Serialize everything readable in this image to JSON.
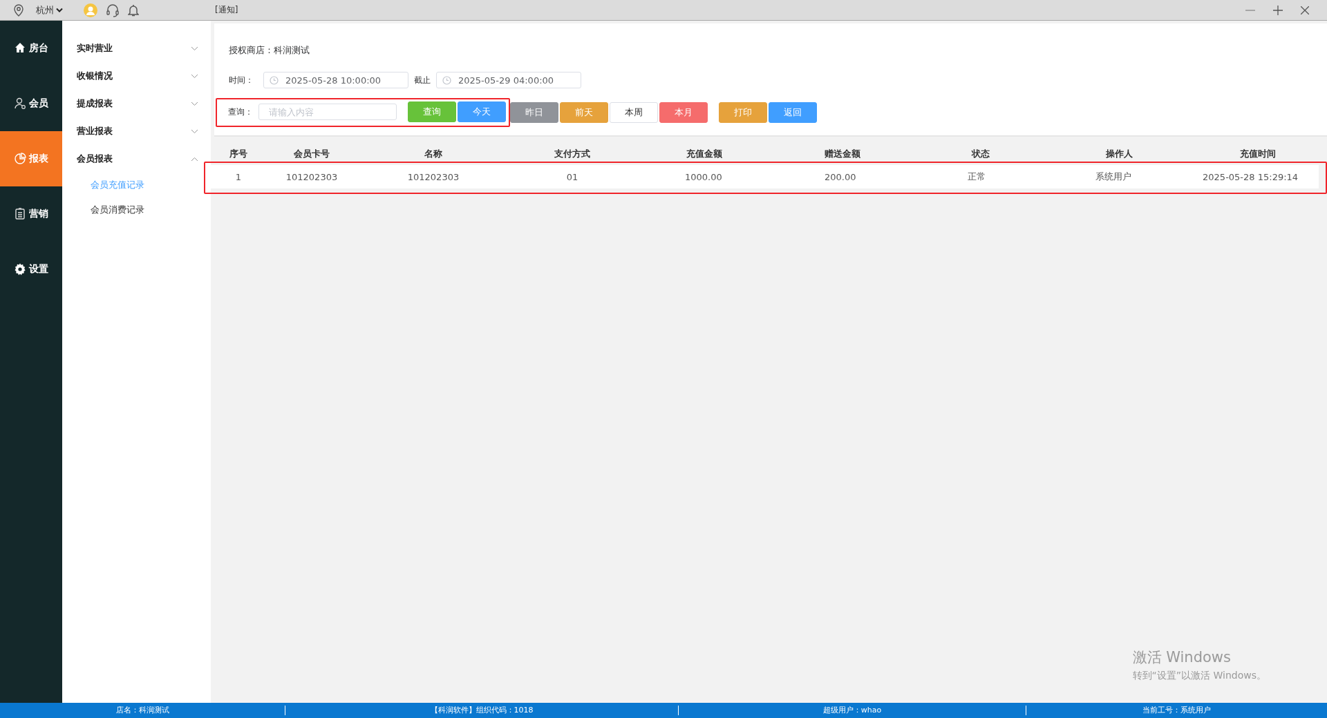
{
  "title_bar": {
    "city": "杭州",
    "notice": "[通知]"
  },
  "nav": [
    {
      "label": "房台",
      "selected": false
    },
    {
      "label": "会员",
      "selected": false
    },
    {
      "label": "报表",
      "selected": true
    },
    {
      "label": "营销",
      "selected": false
    },
    {
      "label": "设置",
      "selected": false
    }
  ],
  "menu": [
    {
      "label": "实时营业",
      "expanded": false
    },
    {
      "label": "收银情况",
      "expanded": false
    },
    {
      "label": "提成报表",
      "expanded": false
    },
    {
      "label": "营业报表",
      "expanded": false
    },
    {
      "label": "会员报表",
      "expanded": true,
      "children": [
        {
          "label": "会员充值记录",
          "selected": true
        },
        {
          "label": "会员消费记录",
          "selected": false
        }
      ]
    }
  ],
  "filter": {
    "shop": "授权商店：科润测试",
    "time_label": "时间：",
    "start": "2025-05-28 10:00:00",
    "until_label": "截止",
    "end": "2025-05-29 04:00:00",
    "query_label": "查询：",
    "placeholder": "请输入内容",
    "query_highlighted": true,
    "buttons": [
      {
        "label": "查询",
        "kind": "success"
      },
      {
        "label": "今天",
        "kind": "primary"
      },
      {
        "label": "昨日",
        "kind": "info"
      },
      {
        "label": "前天",
        "kind": "warning"
      },
      {
        "label": "本周",
        "kind": "plain"
      },
      {
        "label": "本月",
        "kind": "danger"
      },
      {
        "label": "打印",
        "kind": "warning"
      },
      {
        "label": "返回",
        "kind": "primary"
      }
    ]
  },
  "table": {
    "columns": [
      "序号",
      "会员卡号",
      "名称",
      "支付方式",
      "充值金额",
      "赠送金额",
      "状态",
      "操作人",
      "充值时间"
    ],
    "rows": [
      {
        "highlighted": true,
        "cells": [
          "1",
          "101202303",
          "101202303",
          "01",
          "1000.00",
          "200.00",
          "正常",
          "系统用户",
          "2025-05-28 15:29:14"
        ]
      }
    ]
  },
  "activation_notice": {
    "title": "激活 Windows",
    "text": "转到“设置”以激活 Windows。"
  },
  "status_bar": [
    "店名：科润测试",
    "【科润软件】组织代码：1018",
    "超级用户：whao",
    "当前工号：系统用户"
  ]
}
